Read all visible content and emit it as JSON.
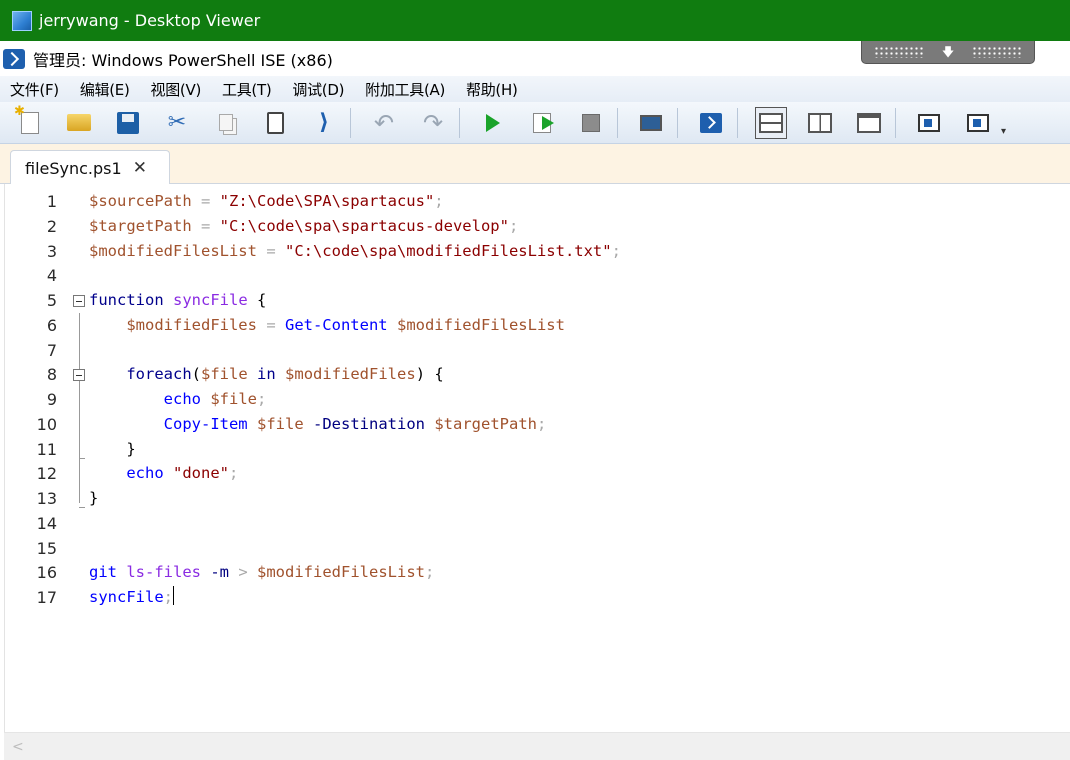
{
  "viewer": {
    "title": "jerrywang - Desktop Viewer"
  },
  "window": {
    "title": "管理员: Windows PowerShell ISE (x86)"
  },
  "menu": [
    "文件(F)",
    "编辑(E)",
    "视图(V)",
    "工具(T)",
    "调试(D)",
    "附加工具(A)",
    "帮助(H)"
  ],
  "toolbar": {
    "buttons": [
      "new-icon",
      "open-icon",
      "save-icon",
      "cut-icon",
      "copy-icon",
      "paste-icon",
      "clear-console-icon",
      "undo-icon",
      "redo-icon",
      "run-icon",
      "run-selection-icon",
      "stop-icon",
      "new-remote-tab-icon",
      "start-powershell-icon",
      "script-pane-top-icon",
      "script-pane-right-icon",
      "script-pane-maximized-icon",
      "show-command-window-icon",
      "show-command-addon-icon"
    ],
    "active": "script-pane-top-icon"
  },
  "tab": {
    "label": "fileSync.ps1",
    "close": "✕"
  },
  "editor": {
    "line_numbers": [
      "1",
      "2",
      "3",
      "4",
      "5",
      "6",
      "7",
      "8",
      "9",
      "10",
      "11",
      "12",
      "13",
      "14",
      "15",
      "16",
      "17"
    ],
    "lines": [
      [
        {
          "t": "$sourcePath",
          "c": "var"
        },
        {
          "t": " = ",
          "c": "op"
        },
        {
          "t": "\"Z:\\Code\\SPA\\spartacus\"",
          "c": "str"
        },
        {
          "t": ";",
          "c": "op"
        }
      ],
      [
        {
          "t": "$targetPath",
          "c": "var"
        },
        {
          "t": " = ",
          "c": "op"
        },
        {
          "t": "\"C:\\code\\spa\\spartacus-develop\"",
          "c": "str"
        },
        {
          "t": ";",
          "c": "op"
        }
      ],
      [
        {
          "t": "$modifiedFilesList",
          "c": "var"
        },
        {
          "t": " = ",
          "c": "op"
        },
        {
          "t": "\"C:\\code\\spa\\modifiedFilesList.txt\"",
          "c": "str"
        },
        {
          "t": ";",
          "c": "op"
        }
      ],
      [],
      [
        {
          "t": "function",
          "c": "kw"
        },
        {
          "t": " ",
          "c": "plain"
        },
        {
          "t": "syncFile",
          "c": "fn"
        },
        {
          "t": " {",
          "c": "plain"
        }
      ],
      [
        {
          "t": "    ",
          "c": "plain"
        },
        {
          "t": "$modifiedFiles",
          "c": "var"
        },
        {
          "t": " = ",
          "c": "op"
        },
        {
          "t": "Get-Content",
          "c": "cmd"
        },
        {
          "t": " ",
          "c": "plain"
        },
        {
          "t": "$modifiedFilesList",
          "c": "var"
        }
      ],
      [],
      [
        {
          "t": "    ",
          "c": "plain"
        },
        {
          "t": "foreach",
          "c": "kw"
        },
        {
          "t": "(",
          "c": "plain"
        },
        {
          "t": "$file",
          "c": "var"
        },
        {
          "t": " ",
          "c": "plain"
        },
        {
          "t": "in",
          "c": "kw"
        },
        {
          "t": " ",
          "c": "plain"
        },
        {
          "t": "$modifiedFiles",
          "c": "var"
        },
        {
          "t": ") {",
          "c": "plain"
        }
      ],
      [
        {
          "t": "        ",
          "c": "plain"
        },
        {
          "t": "echo",
          "c": "cmd"
        },
        {
          "t": " ",
          "c": "plain"
        },
        {
          "t": "$file",
          "c": "var"
        },
        {
          "t": ";",
          "c": "op"
        }
      ],
      [
        {
          "t": "        ",
          "c": "plain"
        },
        {
          "t": "Copy-Item",
          "c": "cmd"
        },
        {
          "t": " ",
          "c": "plain"
        },
        {
          "t": "$file",
          "c": "var"
        },
        {
          "t": " ",
          "c": "plain"
        },
        {
          "t": "-Destination",
          "c": "param"
        },
        {
          "t": " ",
          "c": "plain"
        },
        {
          "t": "$targetPath",
          "c": "var"
        },
        {
          "t": ";",
          "c": "op"
        }
      ],
      [
        {
          "t": "    }",
          "c": "plain"
        }
      ],
      [
        {
          "t": "    ",
          "c": "plain"
        },
        {
          "t": "echo",
          "c": "cmd"
        },
        {
          "t": " ",
          "c": "plain"
        },
        {
          "t": "\"done\"",
          "c": "str"
        },
        {
          "t": ";",
          "c": "op"
        }
      ],
      [
        {
          "t": "}",
          "c": "plain"
        }
      ],
      [],
      [],
      [
        {
          "t": "git",
          "c": "cmd"
        },
        {
          "t": " ",
          "c": "plain"
        },
        {
          "t": "ls-files",
          "c": "fn"
        },
        {
          "t": " ",
          "c": "plain"
        },
        {
          "t": "-m",
          "c": "param"
        },
        {
          "t": " > ",
          "c": "op"
        },
        {
          "t": "$modifiedFilesList",
          "c": "var"
        },
        {
          "t": ";",
          "c": "op"
        }
      ],
      [
        {
          "t": "syncFile",
          "c": "cmd"
        },
        {
          "t": ";",
          "c": "op"
        }
      ]
    ],
    "cursor_line": 17
  },
  "scrollbar": {
    "left_arrow": "<"
  },
  "colors": {
    "viewer_bar": "#107c10",
    "tab_strip": "#fdf3e3",
    "variable": "#a0522d",
    "string": "#8b0000",
    "keyword": "#00008b",
    "command": "#0000ff"
  }
}
